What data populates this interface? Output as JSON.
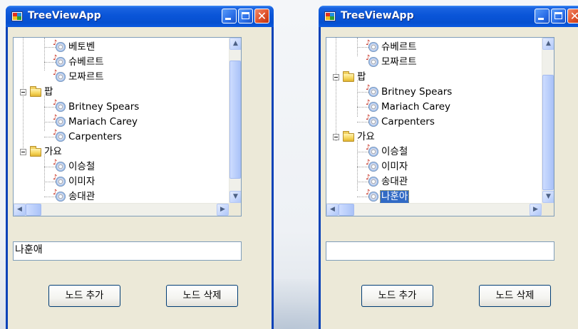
{
  "windows": [
    {
      "title": "TreeViewApp",
      "textbox_value": "나훈애",
      "buttons": {
        "add": "노드 추가",
        "delete": "노드 삭제"
      },
      "tree": {
        "group_labels": [
          "팝",
          "가요"
        ],
        "rows": [
          "베토벤",
          "슈베르트",
          "모짜르트",
          "팝",
          "Britney Spears",
          "Mariach Carey",
          "Carpenters",
          "가요",
          "이승철",
          "이미자",
          "송대관"
        ]
      }
    },
    {
      "title": "TreeViewApp",
      "textbox_value": "",
      "buttons": {
        "add": "노드 추가",
        "delete": "노드 삭제"
      },
      "tree": {
        "rows": [
          "슈베르트",
          "모짜르트",
          "팝",
          "Britney Spears",
          "Mariach Carey",
          "Carpenters",
          "가요",
          "이승철",
          "이미자",
          "송대관",
          "나훈아"
        ],
        "selected": "나훈아"
      }
    }
  ],
  "icons": {
    "app": "app-window-icon",
    "leaf": "music-cd-icon",
    "group": "folder-icon",
    "expander": "collapse-minus-icon"
  },
  "colors": {
    "titlebar": "#0a55d8",
    "selection": "#316ac5",
    "client": "#ece9d8"
  }
}
